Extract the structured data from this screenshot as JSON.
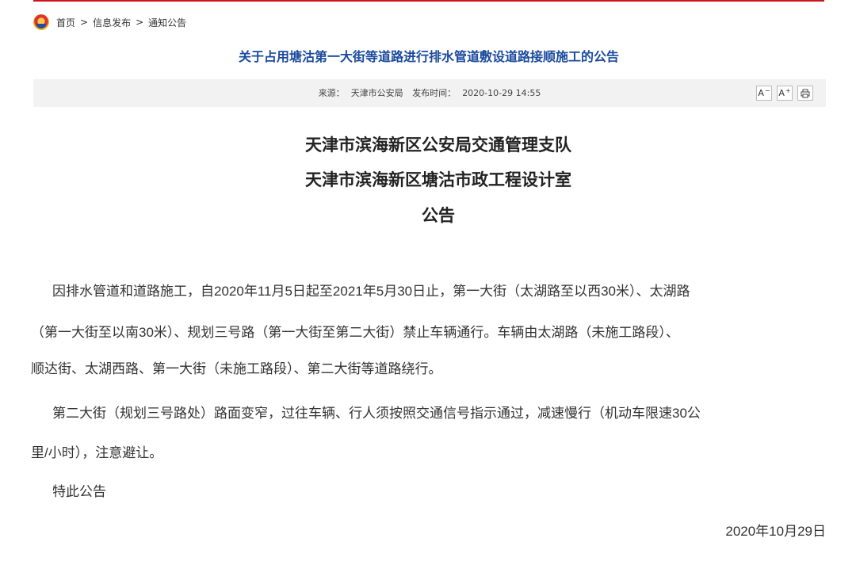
{
  "breadcrumb": {
    "home": "首页",
    "sep1": ">",
    "info": "信息发布",
    "sep2": ">",
    "current": "通知公告"
  },
  "page_title": "关于占用塘沽第一大街等道路进行排水管道敷设道路接顺施工的公告",
  "meta": {
    "source_label": "来源：",
    "source_value": "天津市公安局",
    "time_label": "发布时间：",
    "time_value": "2020-10-29 14:55"
  },
  "tools": {
    "font_decrease": "A",
    "font_decrease_sup": "−",
    "font_increase": "A",
    "font_increase_sup": "+",
    "print_icon": "printer-icon"
  },
  "article": {
    "heading_lines": [
      "天津市滨海新区公安局交通管理支队",
      "天津市滨海新区塘沽市政工程设计室",
      "公告"
    ],
    "lines": [
      "因排水管道和道路施工，自2020年11月5日起至2021年5月30日止，第一大街（太湖路至以西30米）、太湖路",
      "（第一大街至以南30米）、规划三号路（第一大街至第二大街）禁止车辆通行。车辆由太湖路（未施工路段）、",
      "顺达街、太湖西路、第一大街（未施工路段）、第二大街等道路绕行。",
      "第二大街（规划三号路处）路面变窄，过往车辆、行人须按照交通信号指示通过，减速慢行（机动车限速30公",
      "里/小时），注意避让。",
      "特此公告"
    ],
    "date": "2020年10月29日"
  },
  "colors": {
    "accent_red": "#c8161d",
    "title_blue": "#1a4a9c",
    "meta_bg": "#f2f2f2"
  }
}
